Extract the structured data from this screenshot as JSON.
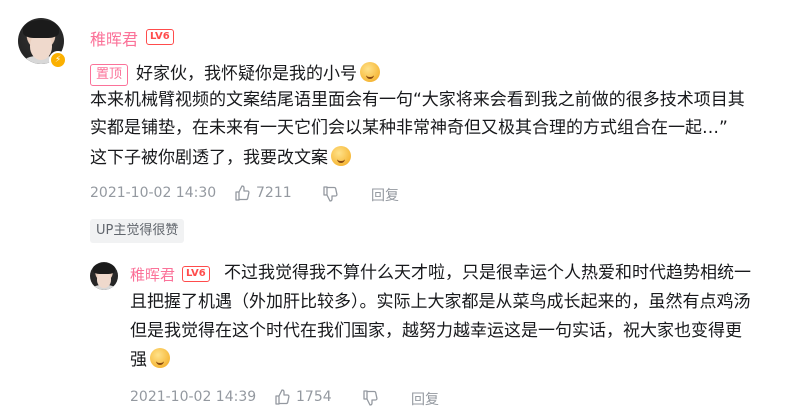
{
  "comment": {
    "username": "稚晖君",
    "level": "LV6",
    "pin_label": "置顶",
    "lines": [
      "好家伙，我怀疑你是我的小号",
      "本来机械臂视频的文案结尾语里面会有一句“大家将来会看到我之前做的很多技术项目其",
      "实都是铺垫，在未来有一天它们会以某种非常神奇但又极其合理的方式组合在一起…”",
      "这下子被你剧透了，我要改文案"
    ],
    "timestamp": "2021-10-02 14:30",
    "likes": "7211",
    "reply_label": "回复",
    "up_badge": "UP主觉得很赞",
    "emoji_icons": [
      "doubt-emoji-icon",
      "embarrassed-emoji-icon"
    ]
  },
  "reply": {
    "username": "稚晖君",
    "level": "LV6",
    "lines": [
      "不过我觉得我不算什么天才啦，只是很幸运个人热爱和时代趋势相统一",
      "且把握了机遇（外加肝比较多）。实际上大家都是从菜鸟成长起来的，虽然有点鸡汤",
      "但是我觉得在这个时代在我们国家，越努力越幸运这是一句实话，祝大家也变得更",
      "强"
    ],
    "timestamp": "2021-10-02 14:39",
    "likes": "1754",
    "reply_label": "回复",
    "emoji_icons": [
      "fist-emoji-icon"
    ]
  },
  "colors": {
    "accent_pink": "#fb7299",
    "level_red": "#ff4c4c",
    "meta_gray": "#9499a0",
    "verify_yellow": "#fbb000"
  }
}
